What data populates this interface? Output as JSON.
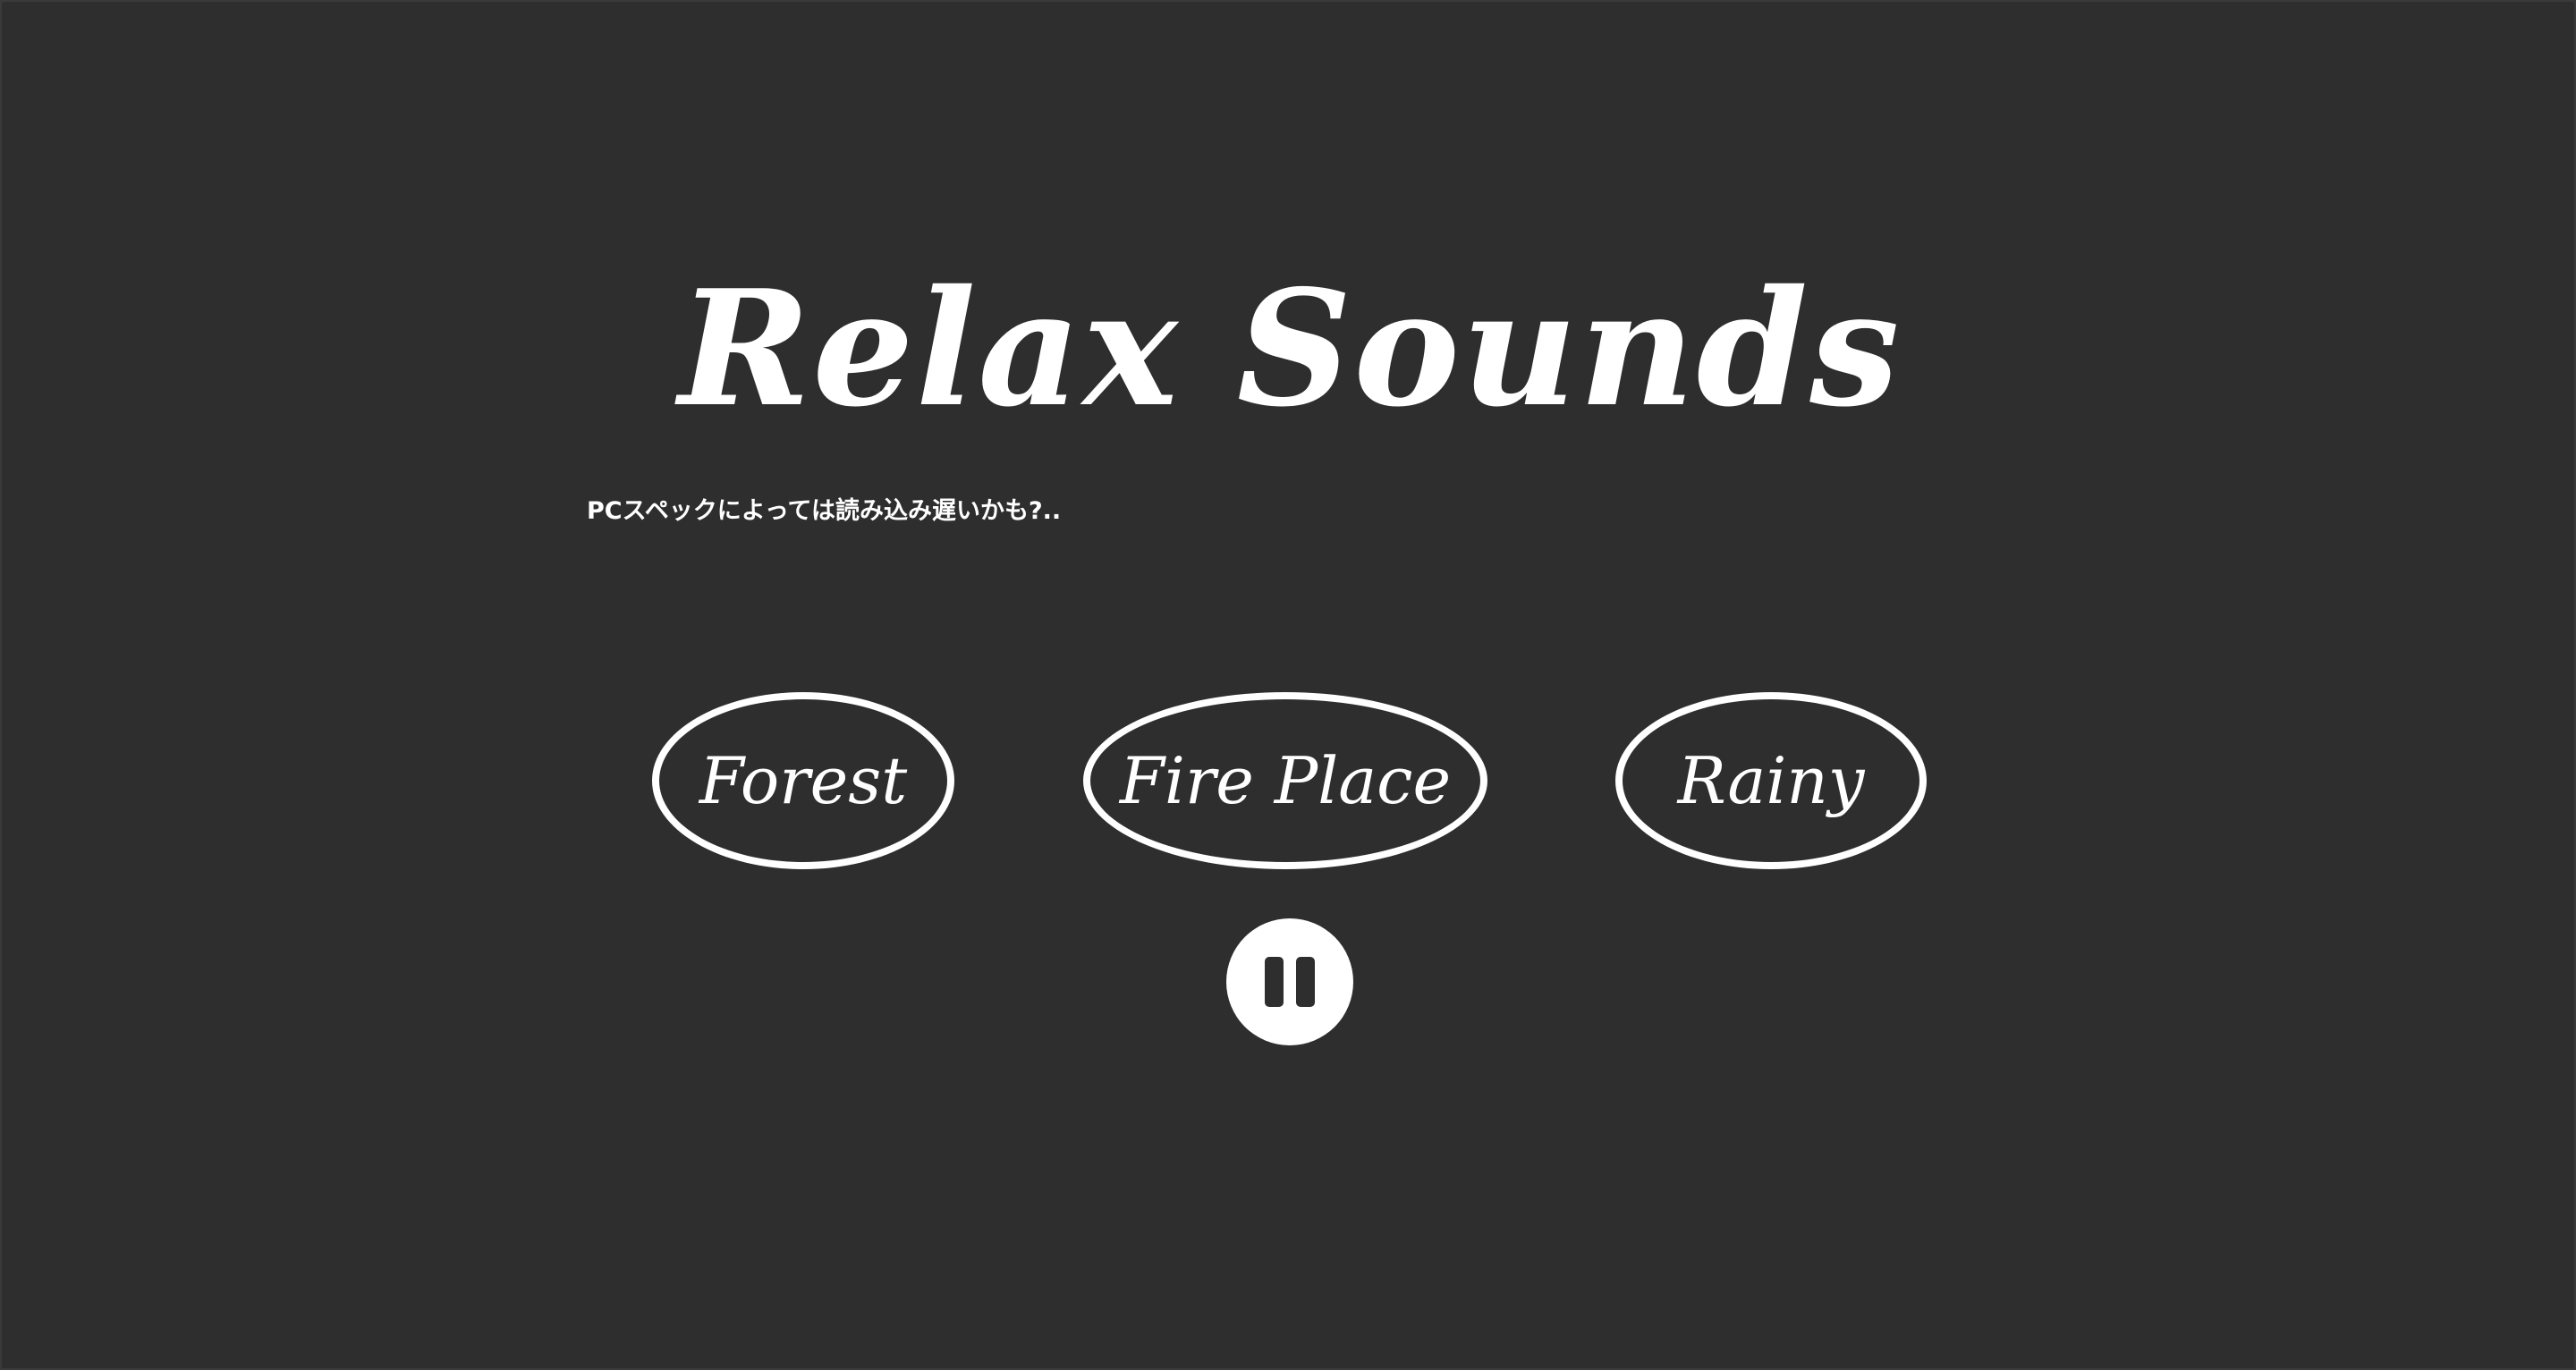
{
  "header": {
    "title": "Relax Sounds",
    "note": "PCスペックによっては読み込み遅いかも?.."
  },
  "sounds": [
    {
      "label": "Forest"
    },
    {
      "label": "Fire Place"
    },
    {
      "label": "Rainy"
    }
  ],
  "controls": {
    "pause_icon": "pause-icon"
  },
  "colors": {
    "background": "#2e2e2e",
    "foreground": "#ffffff"
  }
}
